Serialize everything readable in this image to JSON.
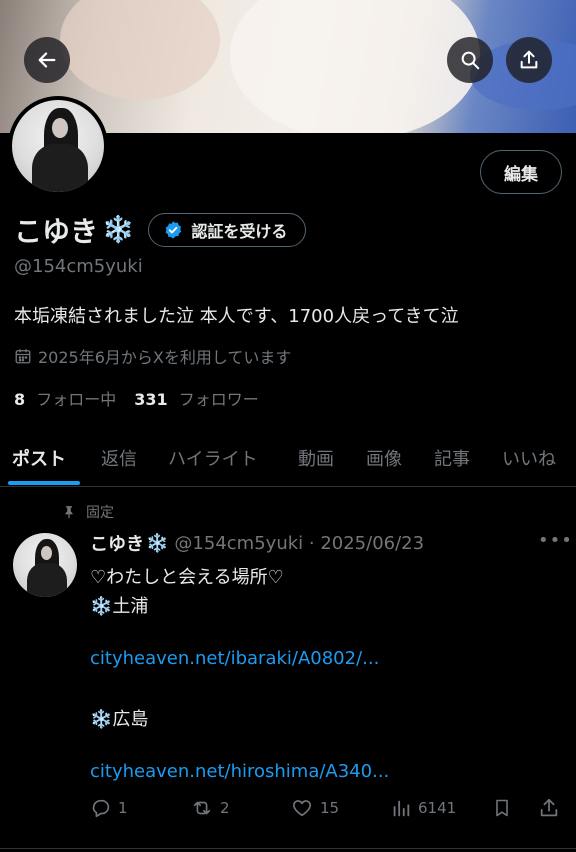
{
  "header": {
    "back_icon": "arrow-left-icon",
    "search_icon": "search-icon",
    "share_icon": "share-icon"
  },
  "profile": {
    "edit_label": "編集",
    "display_name": "こゆき",
    "name_emoji": "❄️",
    "verify_label": "認証を受ける",
    "handle": "@154cm5yuki",
    "bio": "本垢凍結されました泣 本人です、1700人戻ってきて泣",
    "joined": "2025年6月からXを利用しています",
    "following_count": "8",
    "following_label": "フォロー中",
    "followers_count": "331",
    "followers_label": "フォロワー"
  },
  "tabs": [
    "ポスト",
    "返信",
    "ハイライト",
    "動画",
    "画像",
    "記事",
    "いいね"
  ],
  "active_tab": "ポスト",
  "tweet": {
    "pinned_label": "固定",
    "name": "こゆき",
    "name_emoji": "❄️",
    "handle": "@154cm5yuki",
    "date": "2025/06/23",
    "line1": "♡わたしと会える場所♡",
    "place1_emoji": "❄️",
    "place1": "土浦",
    "link1": "cityheaven.net/ibaraki/A0802/...",
    "place2_emoji": "❄️",
    "place2": "広島",
    "link2": "cityheaven.net/hiroshima/A340...",
    "replies": "1",
    "reposts": "2",
    "likes": "15",
    "views": "6141"
  },
  "colors": {
    "accent": "#1d9bf0",
    "muted": "#71767b",
    "text": "#e7e9ea",
    "background": "#000000"
  }
}
